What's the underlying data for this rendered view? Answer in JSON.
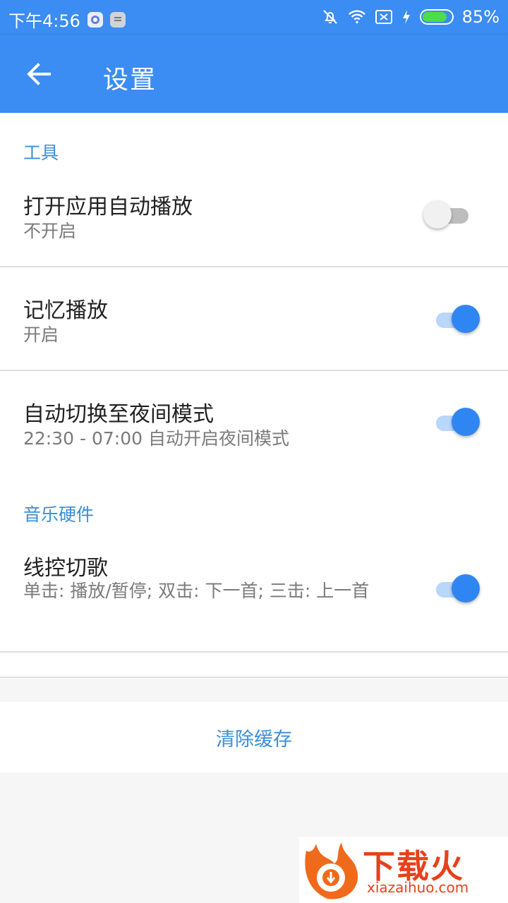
{
  "status_bar": {
    "time": "下午4:56",
    "battery_percent": "85%",
    "battery_level": 0.85,
    "icons": [
      "app-icon",
      "notification-icon",
      "mute-bell-icon",
      "wifi-icon",
      "sim-none-icon",
      "charging-icon",
      "battery-icon"
    ]
  },
  "app_bar": {
    "back_icon": "arrow-left-icon",
    "title": "设置"
  },
  "sections": {
    "tools_header": "工具",
    "music_hw_header": "音乐硬件"
  },
  "items": {
    "autoplay": {
      "title": "打开应用自动播放",
      "subtitle": "不开启",
      "on": false
    },
    "memory": {
      "title": "记忆播放",
      "subtitle": "开启",
      "on": true
    },
    "night": {
      "title": "自动切换至夜间模式",
      "subtitle": "22:30 - 07:00 自动开启夜间模式",
      "on": true
    },
    "wire": {
      "title": "线控切歌",
      "subtitle": "单击: 播放/暂停; 双击: 下一首; 三击: 上一首",
      "on": true
    }
  },
  "clear_cache": "清除缓存",
  "watermark": {
    "brand": "下载火",
    "domain": "xiazaihuo.com"
  },
  "colors": {
    "primary": "#3b8cf3",
    "accent_text": "#3a8fdc",
    "switch_on_thumb": "#2f86f3",
    "switch_on_track": "#b9d6fb"
  }
}
